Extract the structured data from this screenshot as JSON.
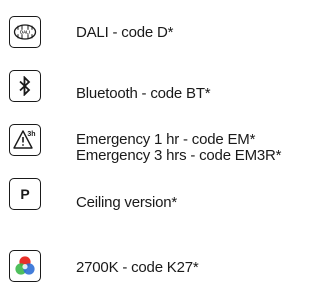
{
  "features": [
    {
      "icon": "dali-icon",
      "icon_text": "DALI",
      "lines": [
        "DALI - code D*"
      ]
    },
    {
      "icon": "bluetooth-icon",
      "lines": [
        "Bluetooth - code BT*"
      ]
    },
    {
      "icon": "emergency-warning-icon",
      "icon_text": "3h",
      "lines": [
        "Emergency 1 hr - code EM*",
        "Emergency 3 hrs - code EM3R*"
      ]
    },
    {
      "icon": "ceiling-p-icon",
      "icon_text": "P",
      "lines": [
        "Ceiling version*"
      ]
    },
    {
      "icon": "color-temperature-icon",
      "lines": [
        "2700K - code K27*"
      ]
    }
  ],
  "colors": {
    "text": "#1a1a1a",
    "icon_border": "#1a1a1a",
    "rgb_red": "#e8302a",
    "rgb_green": "#3cb84a",
    "rgb_blue": "#2f6fd6"
  }
}
